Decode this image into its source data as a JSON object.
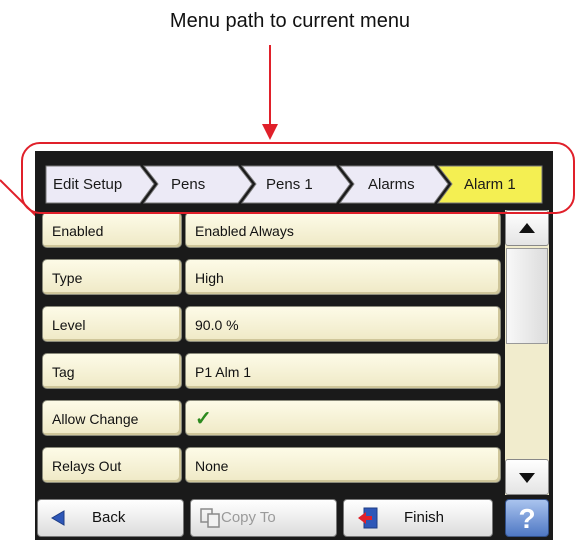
{
  "annotation": {
    "title": "Menu path to current menu"
  },
  "breadcrumb": [
    {
      "label": "Edit Setup"
    },
    {
      "label": "Pens"
    },
    {
      "label": "Pens 1"
    },
    {
      "label": "Alarms"
    },
    {
      "label": "Alarm 1",
      "current": true
    }
  ],
  "rows": [
    {
      "label": "Enabled",
      "value": "Enabled Always"
    },
    {
      "label": "Type",
      "value": "High"
    },
    {
      "label": "Level",
      "value": "90.0 %"
    },
    {
      "label": "Tag",
      "value": "P1 Alm 1"
    },
    {
      "label": "Allow Change",
      "value": "✓",
      "value_icon": "check-icon"
    },
    {
      "label": "Relays Out",
      "value": "None"
    }
  ],
  "toolbar": {
    "back_label": "Back",
    "copy_to_label": "Copy To",
    "finish_label": "Finish",
    "help_label": "?"
  },
  "colors": {
    "breadcrumb_fill": "#eceaf6",
    "breadcrumb_current_fill": "#f4ef52",
    "row_fill": "#fbf8df",
    "annotation_red": "#e0202a",
    "help_blue": "#4f78c4"
  }
}
